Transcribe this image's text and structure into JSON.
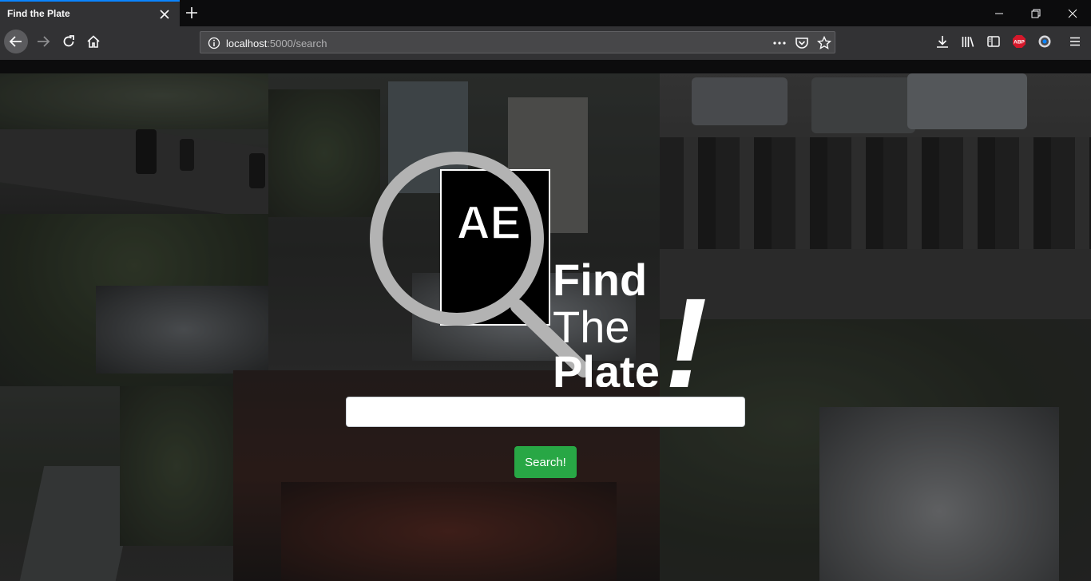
{
  "browser": {
    "tab_title": "Find the Plate",
    "url_host": "localhost",
    "url_path": ":5000/search",
    "addon_badge": "ABP"
  },
  "page": {
    "logo": {
      "plate_text": "AE",
      "line1": "Find",
      "line2": "The",
      "line3": "Plate",
      "exclamation": "!"
    },
    "search_input_value": "",
    "search_input_placeholder": "",
    "search_button_label": "Search!"
  },
  "colors": {
    "tab_accent": "#0a84ff",
    "toolbar": "#323234",
    "button_green": "#28a745",
    "logo_gray": "#b3b3b3"
  }
}
